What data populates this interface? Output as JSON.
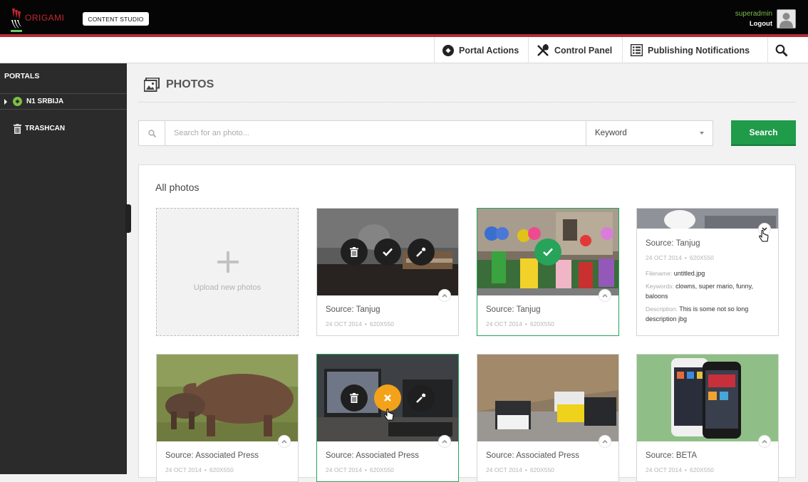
{
  "app": {
    "logo_text": "ORIGAMI",
    "studio_label": "CONTENT STUDIO"
  },
  "user": {
    "name": "superadmin",
    "logout": "Logout"
  },
  "nav": {
    "portal_actions": "Portal Actions",
    "control_panel": "Control Panel",
    "publishing_notifications": "Publishing Notifications"
  },
  "sidebar": {
    "title": "PORTALS",
    "items": [
      {
        "label": "N1 SRBIJA",
        "icon": "globe-icon"
      },
      {
        "label": "TRASHCAN",
        "icon": "trash-icon"
      }
    ]
  },
  "page": {
    "title": "PHOTOS"
  },
  "search": {
    "placeholder": "Search for an photo...",
    "filter_value": "Keyword",
    "button": "Search"
  },
  "panel": {
    "title": "All photos",
    "upload_label": "Upload new photos"
  },
  "photos": [
    {
      "source": "Source: Tanjug",
      "date": "24 OCT 2014",
      "size": "620X550",
      "state": "hover"
    },
    {
      "source": "Source: Tanjug",
      "date": "24 OCT 2014",
      "size": "620X550",
      "state": "selected"
    },
    {
      "source": "Source: Tanjug",
      "date": "24 OCT 2014",
      "size": "620X550",
      "state": "expanded",
      "filename_label": "Filename:",
      "filename": "untitled.jpg",
      "keywords_label": "Keywords:",
      "keywords": "clowns, super mario, funny, baloons",
      "description_label": "Description:",
      "description": "This is some not so long description jbg"
    },
    {
      "source": "Source: Associated Press",
      "date": "24 OCT 2014",
      "size": "620X550",
      "state": "normal"
    },
    {
      "source": "Source: Associated Press",
      "date": "24 OCT 2014",
      "size": "620X550",
      "state": "hover-selected"
    },
    {
      "source": "Source: Associated Press",
      "date": "24 OCT 2014",
      "size": "620X550",
      "state": "normal"
    },
    {
      "source": "Source: BETA",
      "date": "24 OCT 2014",
      "size": "620X550",
      "state": "normal"
    }
  ],
  "colors": {
    "accent_green": "#1f9b4a",
    "brand_red": "#c8262f",
    "remove_orange": "#f3a21a"
  }
}
